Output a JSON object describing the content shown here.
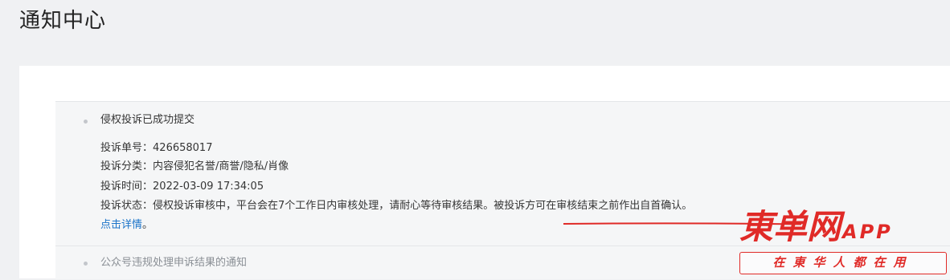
{
  "page": {
    "title": "通知中心"
  },
  "notifications": [
    {
      "title": "侵权投诉已成功提交",
      "fields": [
        {
          "label": "投诉单号",
          "value": "426658017"
        },
        {
          "label": "投诉分类",
          "value": "内容侵犯名誉/商誉/隐私/肖像"
        },
        {
          "label": "投诉时间",
          "value": "2022-03-09 17:34:05"
        },
        {
          "label": "投诉状态",
          "value": "侵权投诉审核中，平台会在7个工作日内审核处理，请耐心等待审核结果。被投诉方可在审核结束之前作出自首确认。"
        }
      ],
      "detail_link": "点击详情",
      "detail_tail": "。"
    },
    {
      "title": "公众号违规处理申诉结果的通知"
    }
  ],
  "watermark": {
    "brand": "東单网",
    "app": "APP",
    "slogan": "在東华人都在用"
  },
  "colors": {
    "link": "#1a73c9",
    "annotation_red": "#e02a27",
    "background": "#f0f1f3"
  }
}
